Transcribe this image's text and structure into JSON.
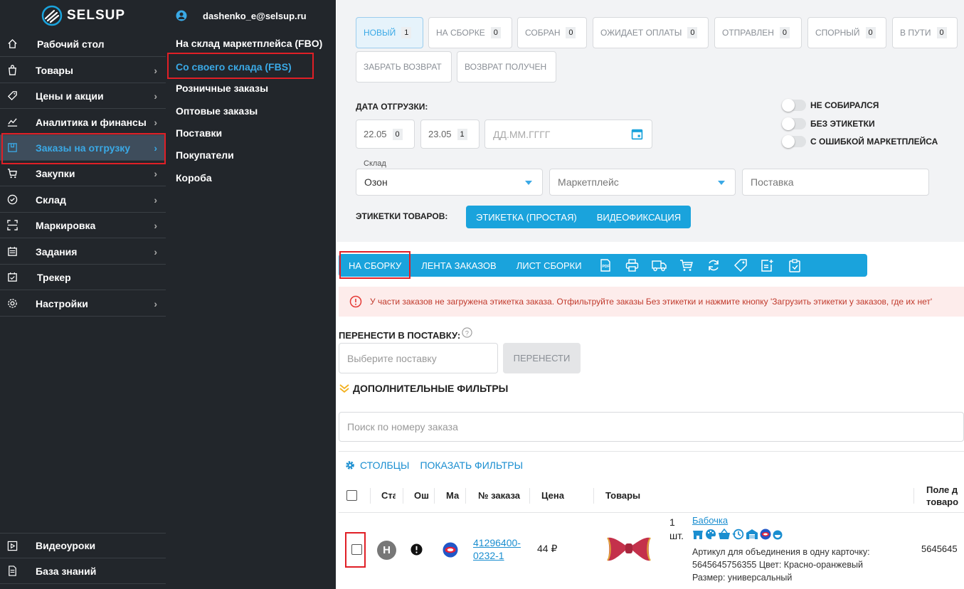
{
  "sidebar": {
    "logo_text": "SELSUP",
    "items": [
      {
        "label": "Рабочий стол",
        "icon": "home-icon",
        "has_chevron": false
      },
      {
        "label": "Товары",
        "icon": "bag-icon",
        "has_chevron": true
      },
      {
        "label": "Цены и акции",
        "icon": "tag-icon",
        "has_chevron": true
      },
      {
        "label": "Аналитика и финансы",
        "icon": "chart-icon",
        "has_chevron": true
      },
      {
        "label": "Заказы на отгрузку",
        "icon": "box-icon",
        "has_chevron": true
      },
      {
        "label": "Закупки",
        "icon": "cart-icon",
        "has_chevron": true
      },
      {
        "label": "Склад",
        "icon": "check-circle-icon",
        "has_chevron": true
      },
      {
        "label": "Маркировка",
        "icon": "scan-icon",
        "has_chevron": true
      },
      {
        "label": "Задания",
        "icon": "calendar-list-icon",
        "has_chevron": true
      },
      {
        "label": "Трекер",
        "icon": "calendar-check-icon",
        "has_chevron": false
      },
      {
        "label": "Настройки",
        "icon": "gear-icon",
        "has_chevron": true
      }
    ],
    "bottom_items": [
      {
        "label": "Видеоуроки",
        "icon": "play-icon"
      },
      {
        "label": "База знаний",
        "icon": "document-icon"
      }
    ]
  },
  "submenu": {
    "user_email": "dashenko_e@selsup.ru",
    "items": [
      "На склад маркетплейса (FBO)",
      "Со своего склада (FBS)",
      "Розничные заказы",
      "Оптовые заказы",
      "Поставки",
      "Покупатели",
      "Короба"
    ]
  },
  "status_filters": [
    {
      "label": "НОВЫЙ",
      "count": "1"
    },
    {
      "label": "НА СБОРКЕ",
      "count": "0"
    },
    {
      "label": "СОБРАН",
      "count": "0"
    },
    {
      "label": "ОЖИДАЕТ ОПЛАТЫ",
      "count": "0"
    },
    {
      "label": "ОТПРАВЛЕН",
      "count": "0"
    },
    {
      "label": "СПОРНЫЙ",
      "count": "0"
    },
    {
      "label": "В ПУТИ",
      "count": "0"
    },
    {
      "label": "ЗАБРАТЬ ВОЗВРАТ",
      "count": ""
    },
    {
      "label": "ВОЗВРАТ ПОЛУЧЕН",
      "count": ""
    }
  ],
  "shipment_date": {
    "label": "ДАТА ОТГРУЗКИ:",
    "chips": [
      {
        "date": "22.05",
        "count": "0"
      },
      {
        "date": "23.05",
        "count": "1"
      }
    ],
    "placeholder": "ДД.ММ.ГГГГ"
  },
  "toggles": [
    "НЕ СОБИРАЛСЯ",
    "БЕЗ ЭТИКЕТКИ",
    "С ОШИБКОЙ МАРКЕТПЛЕЙСА"
  ],
  "filters": {
    "warehouse_label": "Склад",
    "warehouse_value": "Озон",
    "marketplace_placeholder": "Маркетплейс",
    "supply_placeholder": "Поставка"
  },
  "labels_row": {
    "label": "ЭТИКЕТКИ ТОВАРОВ:",
    "buttons": [
      "ЭТИКЕТКА (ПРОСТАЯ)",
      "ВИДЕОФИКСАЦИЯ"
    ]
  },
  "toolbar": {
    "tabs": [
      "НА СБОРКУ",
      "ЛЕНТА ЗАКАЗОВ",
      "ЛИСТ СБОРКИ"
    ],
    "icons": [
      "pdf-icon",
      "printer-icon",
      "truck-icon",
      "cart-icon",
      "refresh-icon",
      "label-icon",
      "add-note-icon",
      "clipboard-icon"
    ]
  },
  "alert_text": "У части заказов не загружена этикетка заказа. Отфильтруйте заказы Без этикетки и нажмите кнопку 'Загрузить этикетки у заказов, где их нет'",
  "move": {
    "label": "ПЕРЕНЕСТИ В ПОСТАВКУ:",
    "placeholder": "Выберите поставку",
    "button": "ПЕРЕНЕСТИ"
  },
  "extra_filters": "ДОПОЛНИТЕЛЬНЫЕ ФИЛЬТРЫ",
  "search_placeholder": "Поиск по номеру заказа",
  "table_actions": {
    "columns": "СТОЛБЦЫ",
    "show_filters": "ПОКАЗАТЬ ФИЛЬТРЫ"
  },
  "table_headers": [
    "Ста",
    "Ош",
    "Ма",
    "№ заказа",
    "Цена",
    "Товары",
    "Поле д",
    "товаро"
  ],
  "order_row": {
    "status_letter": "Н",
    "order_number_line1": "41296400-",
    "order_number_line2": "0232-1",
    "price": "44 ₽",
    "qty_line1": "1",
    "qty_line2": "шт.",
    "product_name": "Бабочка",
    "detail_line1": "Артикул для объединения в одну карточку:",
    "detail_line2": "5645645756355 Цвет: Красно-оранжевый",
    "detail_line3": "Размер: универсальный",
    "extra_value": "5645645"
  },
  "colors": {
    "accent": "#1aa3dc",
    "sidebar": "#22262b",
    "highlight": "#e01f26"
  }
}
